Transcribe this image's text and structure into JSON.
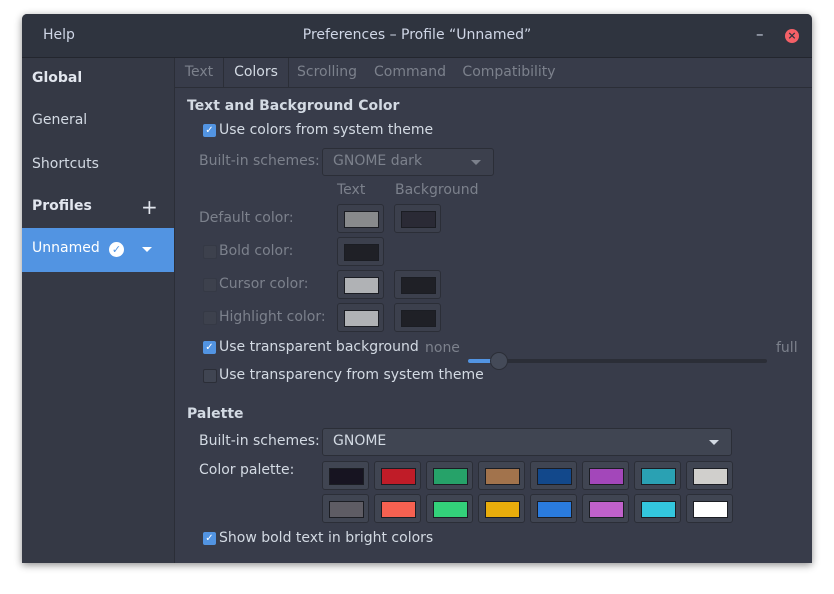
{
  "titlebar": {
    "help_label": "Help",
    "title": "Preferences – Profile “Unnamed”"
  },
  "sidebar": {
    "global_heading": "Global",
    "general": "General",
    "shortcuts": "Shortcuts",
    "profiles_heading": "Profiles",
    "profile_name": "Unnamed"
  },
  "tabs": [
    "Text",
    "Colors",
    "Scrolling",
    "Command",
    "Compatibility"
  ],
  "text_bg": {
    "heading": "Text and Background Color",
    "use_system_theme": "Use colors from system theme",
    "use_system_theme_checked": true,
    "builtin_label": "Built-in schemes:",
    "builtin_value": "GNOME dark",
    "col_text": "Text",
    "col_background": "Background",
    "default_color": "Default color:",
    "bold_color": "Bold color:",
    "cursor_color": "Cursor color:",
    "highlight_color": "Highlight color:",
    "default_text_color": "#888a8c",
    "default_bg_color": "#2a2a35",
    "bold_text_color": "#1f2026",
    "cursor_text_color": "#b0b2b5",
    "cursor_bg_color": "#1f2026",
    "highlight_text_color": "#b0b2b5",
    "highlight_bg_color": "#1f2026",
    "transparent_label": "Use transparent background",
    "transparent_checked": true,
    "slider_min_label": "none",
    "slider_max_label": "full",
    "transparency_level": 0.1,
    "transparency_system_label": "Use transparency from system theme",
    "transparency_system_checked": false
  },
  "palette": {
    "heading": "Palette",
    "builtin_label": "Built-in schemes:",
    "builtin_value": "GNOME",
    "palette_label": "Color palette:",
    "row1": [
      "#171421",
      "#c01c28",
      "#26a269",
      "#a2734c",
      "#12488b",
      "#a347ba",
      "#2aa1b3",
      "#d0cfcc"
    ],
    "row2": [
      "#5e5c64",
      "#f66151",
      "#33d17a",
      "#e9ad0c",
      "#2a7bde",
      "#c061cb",
      "#33c7de",
      "#ffffff"
    ],
    "bold_bright_label": "Show bold text in bright colors",
    "bold_bright_checked": true
  },
  "colors": {
    "accent": "#5294e2",
    "window_bg": "#383c4a",
    "titlebar_bg": "#2f343f",
    "close": "#f46067"
  }
}
